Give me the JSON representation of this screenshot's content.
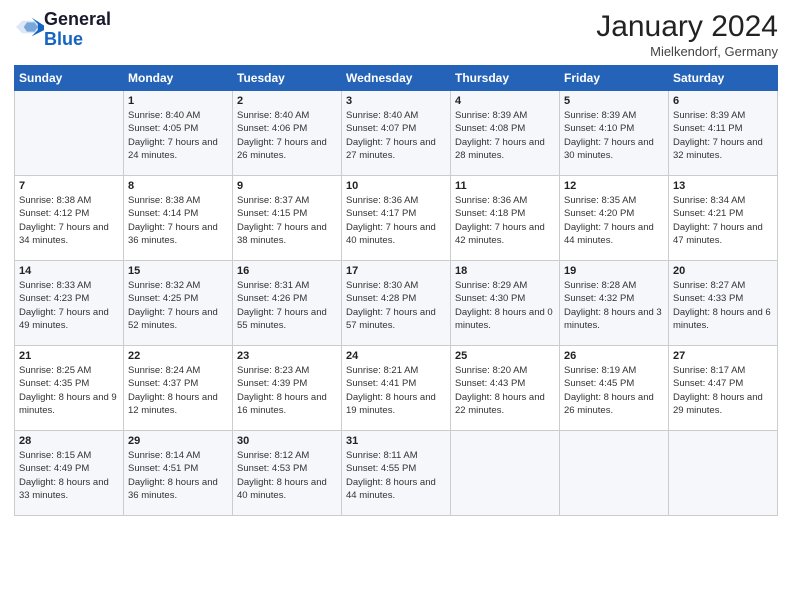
{
  "header": {
    "logo_general": "General",
    "logo_blue": "Blue",
    "cal_title": "January 2024",
    "cal_subtitle": "Mielkendorf, Germany"
  },
  "days_of_week": [
    "Sunday",
    "Monday",
    "Tuesday",
    "Wednesday",
    "Thursday",
    "Friday",
    "Saturday"
  ],
  "weeks": [
    [
      {
        "day": "",
        "sunrise": "",
        "sunset": "",
        "daylight": ""
      },
      {
        "day": "1",
        "sunrise": "Sunrise: 8:40 AM",
        "sunset": "Sunset: 4:05 PM",
        "daylight": "Daylight: 7 hours and 24 minutes."
      },
      {
        "day": "2",
        "sunrise": "Sunrise: 8:40 AM",
        "sunset": "Sunset: 4:06 PM",
        "daylight": "Daylight: 7 hours and 26 minutes."
      },
      {
        "day": "3",
        "sunrise": "Sunrise: 8:40 AM",
        "sunset": "Sunset: 4:07 PM",
        "daylight": "Daylight: 7 hours and 27 minutes."
      },
      {
        "day": "4",
        "sunrise": "Sunrise: 8:39 AM",
        "sunset": "Sunset: 4:08 PM",
        "daylight": "Daylight: 7 hours and 28 minutes."
      },
      {
        "day": "5",
        "sunrise": "Sunrise: 8:39 AM",
        "sunset": "Sunset: 4:10 PM",
        "daylight": "Daylight: 7 hours and 30 minutes."
      },
      {
        "day": "6",
        "sunrise": "Sunrise: 8:39 AM",
        "sunset": "Sunset: 4:11 PM",
        "daylight": "Daylight: 7 hours and 32 minutes."
      }
    ],
    [
      {
        "day": "7",
        "sunrise": "Sunrise: 8:38 AM",
        "sunset": "Sunset: 4:12 PM",
        "daylight": "Daylight: 7 hours and 34 minutes."
      },
      {
        "day": "8",
        "sunrise": "Sunrise: 8:38 AM",
        "sunset": "Sunset: 4:14 PM",
        "daylight": "Daylight: 7 hours and 36 minutes."
      },
      {
        "day": "9",
        "sunrise": "Sunrise: 8:37 AM",
        "sunset": "Sunset: 4:15 PM",
        "daylight": "Daylight: 7 hours and 38 minutes."
      },
      {
        "day": "10",
        "sunrise": "Sunrise: 8:36 AM",
        "sunset": "Sunset: 4:17 PM",
        "daylight": "Daylight: 7 hours and 40 minutes."
      },
      {
        "day": "11",
        "sunrise": "Sunrise: 8:36 AM",
        "sunset": "Sunset: 4:18 PM",
        "daylight": "Daylight: 7 hours and 42 minutes."
      },
      {
        "day": "12",
        "sunrise": "Sunrise: 8:35 AM",
        "sunset": "Sunset: 4:20 PM",
        "daylight": "Daylight: 7 hours and 44 minutes."
      },
      {
        "day": "13",
        "sunrise": "Sunrise: 8:34 AM",
        "sunset": "Sunset: 4:21 PM",
        "daylight": "Daylight: 7 hours and 47 minutes."
      }
    ],
    [
      {
        "day": "14",
        "sunrise": "Sunrise: 8:33 AM",
        "sunset": "Sunset: 4:23 PM",
        "daylight": "Daylight: 7 hours and 49 minutes."
      },
      {
        "day": "15",
        "sunrise": "Sunrise: 8:32 AM",
        "sunset": "Sunset: 4:25 PM",
        "daylight": "Daylight: 7 hours and 52 minutes."
      },
      {
        "day": "16",
        "sunrise": "Sunrise: 8:31 AM",
        "sunset": "Sunset: 4:26 PM",
        "daylight": "Daylight: 7 hours and 55 minutes."
      },
      {
        "day": "17",
        "sunrise": "Sunrise: 8:30 AM",
        "sunset": "Sunset: 4:28 PM",
        "daylight": "Daylight: 7 hours and 57 minutes."
      },
      {
        "day": "18",
        "sunrise": "Sunrise: 8:29 AM",
        "sunset": "Sunset: 4:30 PM",
        "daylight": "Daylight: 8 hours and 0 minutes."
      },
      {
        "day": "19",
        "sunrise": "Sunrise: 8:28 AM",
        "sunset": "Sunset: 4:32 PM",
        "daylight": "Daylight: 8 hours and 3 minutes."
      },
      {
        "day": "20",
        "sunrise": "Sunrise: 8:27 AM",
        "sunset": "Sunset: 4:33 PM",
        "daylight": "Daylight: 8 hours and 6 minutes."
      }
    ],
    [
      {
        "day": "21",
        "sunrise": "Sunrise: 8:25 AM",
        "sunset": "Sunset: 4:35 PM",
        "daylight": "Daylight: 8 hours and 9 minutes."
      },
      {
        "day": "22",
        "sunrise": "Sunrise: 8:24 AM",
        "sunset": "Sunset: 4:37 PM",
        "daylight": "Daylight: 8 hours and 12 minutes."
      },
      {
        "day": "23",
        "sunrise": "Sunrise: 8:23 AM",
        "sunset": "Sunset: 4:39 PM",
        "daylight": "Daylight: 8 hours and 16 minutes."
      },
      {
        "day": "24",
        "sunrise": "Sunrise: 8:21 AM",
        "sunset": "Sunset: 4:41 PM",
        "daylight": "Daylight: 8 hours and 19 minutes."
      },
      {
        "day": "25",
        "sunrise": "Sunrise: 8:20 AM",
        "sunset": "Sunset: 4:43 PM",
        "daylight": "Daylight: 8 hours and 22 minutes."
      },
      {
        "day": "26",
        "sunrise": "Sunrise: 8:19 AM",
        "sunset": "Sunset: 4:45 PM",
        "daylight": "Daylight: 8 hours and 26 minutes."
      },
      {
        "day": "27",
        "sunrise": "Sunrise: 8:17 AM",
        "sunset": "Sunset: 4:47 PM",
        "daylight": "Daylight: 8 hours and 29 minutes."
      }
    ],
    [
      {
        "day": "28",
        "sunrise": "Sunrise: 8:15 AM",
        "sunset": "Sunset: 4:49 PM",
        "daylight": "Daylight: 8 hours and 33 minutes."
      },
      {
        "day": "29",
        "sunrise": "Sunrise: 8:14 AM",
        "sunset": "Sunset: 4:51 PM",
        "daylight": "Daylight: 8 hours and 36 minutes."
      },
      {
        "day": "30",
        "sunrise": "Sunrise: 8:12 AM",
        "sunset": "Sunset: 4:53 PM",
        "daylight": "Daylight: 8 hours and 40 minutes."
      },
      {
        "day": "31",
        "sunrise": "Sunrise: 8:11 AM",
        "sunset": "Sunset: 4:55 PM",
        "daylight": "Daylight: 8 hours and 44 minutes."
      },
      {
        "day": "",
        "sunrise": "",
        "sunset": "",
        "daylight": ""
      },
      {
        "day": "",
        "sunrise": "",
        "sunset": "",
        "daylight": ""
      },
      {
        "day": "",
        "sunrise": "",
        "sunset": "",
        "daylight": ""
      }
    ]
  ]
}
